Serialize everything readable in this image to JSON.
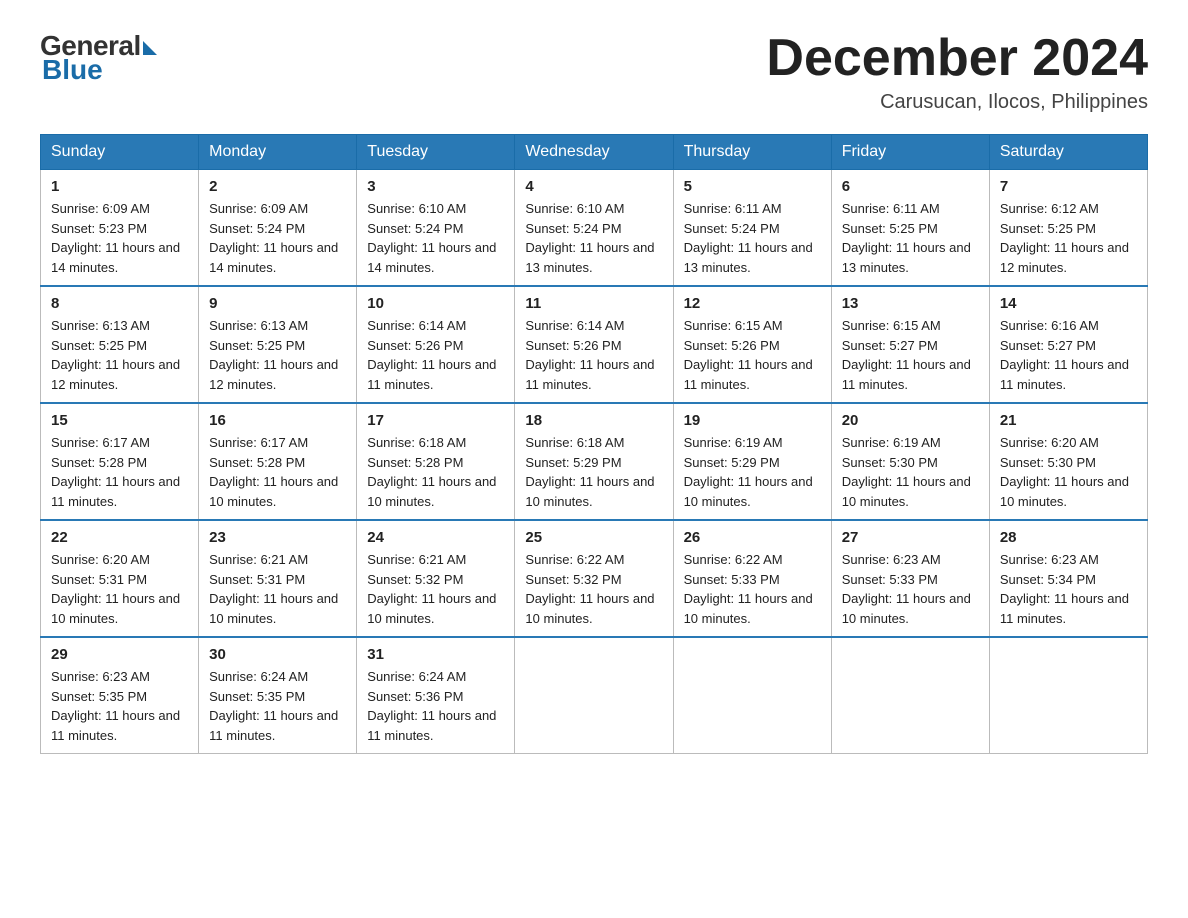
{
  "logo": {
    "general": "General",
    "blue": "Blue"
  },
  "title": "December 2024",
  "location": "Carusucan, Ilocos, Philippines",
  "days_of_week": [
    "Sunday",
    "Monday",
    "Tuesday",
    "Wednesday",
    "Thursday",
    "Friday",
    "Saturday"
  ],
  "weeks": [
    [
      {
        "day": "1",
        "sunrise": "6:09 AM",
        "sunset": "5:23 PM",
        "daylight": "11 hours and 14 minutes."
      },
      {
        "day": "2",
        "sunrise": "6:09 AM",
        "sunset": "5:24 PM",
        "daylight": "11 hours and 14 minutes."
      },
      {
        "day": "3",
        "sunrise": "6:10 AM",
        "sunset": "5:24 PM",
        "daylight": "11 hours and 14 minutes."
      },
      {
        "day": "4",
        "sunrise": "6:10 AM",
        "sunset": "5:24 PM",
        "daylight": "11 hours and 13 minutes."
      },
      {
        "day": "5",
        "sunrise": "6:11 AM",
        "sunset": "5:24 PM",
        "daylight": "11 hours and 13 minutes."
      },
      {
        "day": "6",
        "sunrise": "6:11 AM",
        "sunset": "5:25 PM",
        "daylight": "11 hours and 13 minutes."
      },
      {
        "day": "7",
        "sunrise": "6:12 AM",
        "sunset": "5:25 PM",
        "daylight": "11 hours and 12 minutes."
      }
    ],
    [
      {
        "day": "8",
        "sunrise": "6:13 AM",
        "sunset": "5:25 PM",
        "daylight": "11 hours and 12 minutes."
      },
      {
        "day": "9",
        "sunrise": "6:13 AM",
        "sunset": "5:25 PM",
        "daylight": "11 hours and 12 minutes."
      },
      {
        "day": "10",
        "sunrise": "6:14 AM",
        "sunset": "5:26 PM",
        "daylight": "11 hours and 11 minutes."
      },
      {
        "day": "11",
        "sunrise": "6:14 AM",
        "sunset": "5:26 PM",
        "daylight": "11 hours and 11 minutes."
      },
      {
        "day": "12",
        "sunrise": "6:15 AM",
        "sunset": "5:26 PM",
        "daylight": "11 hours and 11 minutes."
      },
      {
        "day": "13",
        "sunrise": "6:15 AM",
        "sunset": "5:27 PM",
        "daylight": "11 hours and 11 minutes."
      },
      {
        "day": "14",
        "sunrise": "6:16 AM",
        "sunset": "5:27 PM",
        "daylight": "11 hours and 11 minutes."
      }
    ],
    [
      {
        "day": "15",
        "sunrise": "6:17 AM",
        "sunset": "5:28 PM",
        "daylight": "11 hours and 11 minutes."
      },
      {
        "day": "16",
        "sunrise": "6:17 AM",
        "sunset": "5:28 PM",
        "daylight": "11 hours and 10 minutes."
      },
      {
        "day": "17",
        "sunrise": "6:18 AM",
        "sunset": "5:28 PM",
        "daylight": "11 hours and 10 minutes."
      },
      {
        "day": "18",
        "sunrise": "6:18 AM",
        "sunset": "5:29 PM",
        "daylight": "11 hours and 10 minutes."
      },
      {
        "day": "19",
        "sunrise": "6:19 AM",
        "sunset": "5:29 PM",
        "daylight": "11 hours and 10 minutes."
      },
      {
        "day": "20",
        "sunrise": "6:19 AM",
        "sunset": "5:30 PM",
        "daylight": "11 hours and 10 minutes."
      },
      {
        "day": "21",
        "sunrise": "6:20 AM",
        "sunset": "5:30 PM",
        "daylight": "11 hours and 10 minutes."
      }
    ],
    [
      {
        "day": "22",
        "sunrise": "6:20 AM",
        "sunset": "5:31 PM",
        "daylight": "11 hours and 10 minutes."
      },
      {
        "day": "23",
        "sunrise": "6:21 AM",
        "sunset": "5:31 PM",
        "daylight": "11 hours and 10 minutes."
      },
      {
        "day": "24",
        "sunrise": "6:21 AM",
        "sunset": "5:32 PM",
        "daylight": "11 hours and 10 minutes."
      },
      {
        "day": "25",
        "sunrise": "6:22 AM",
        "sunset": "5:32 PM",
        "daylight": "11 hours and 10 minutes."
      },
      {
        "day": "26",
        "sunrise": "6:22 AM",
        "sunset": "5:33 PM",
        "daylight": "11 hours and 10 minutes."
      },
      {
        "day": "27",
        "sunrise": "6:23 AM",
        "sunset": "5:33 PM",
        "daylight": "11 hours and 10 minutes."
      },
      {
        "day": "28",
        "sunrise": "6:23 AM",
        "sunset": "5:34 PM",
        "daylight": "11 hours and 11 minutes."
      }
    ],
    [
      {
        "day": "29",
        "sunrise": "6:23 AM",
        "sunset": "5:35 PM",
        "daylight": "11 hours and 11 minutes."
      },
      {
        "day": "30",
        "sunrise": "6:24 AM",
        "sunset": "5:35 PM",
        "daylight": "11 hours and 11 minutes."
      },
      {
        "day": "31",
        "sunrise": "6:24 AM",
        "sunset": "5:36 PM",
        "daylight": "11 hours and 11 minutes."
      },
      null,
      null,
      null,
      null
    ]
  ],
  "labels": {
    "sunrise": "Sunrise:",
    "sunset": "Sunset:",
    "daylight": "Daylight:"
  }
}
